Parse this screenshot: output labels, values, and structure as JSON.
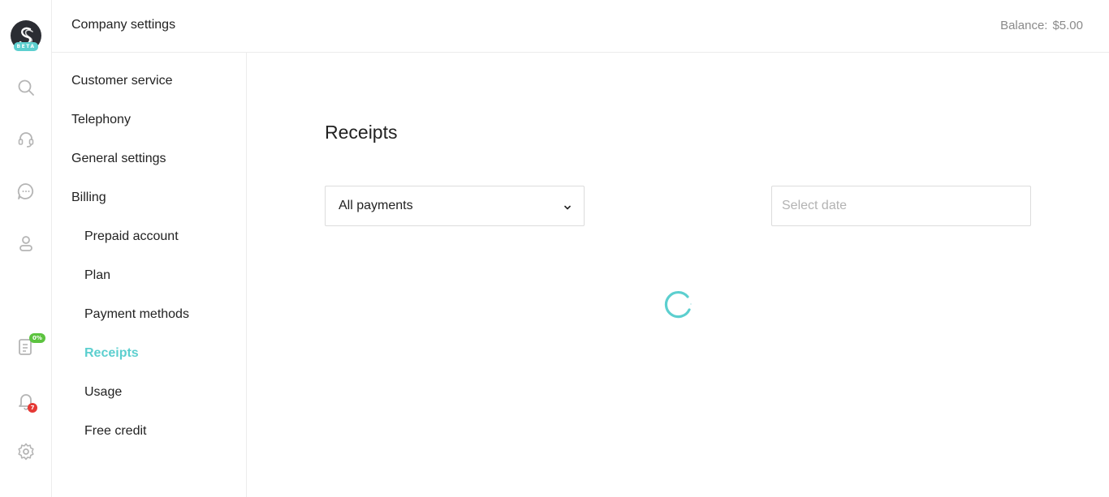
{
  "header": {
    "title": "Company settings",
    "balance_label": "Balance:",
    "balance_value": "$5.00"
  },
  "rail": {
    "logo_badge": "BETA",
    "icons": [
      "search-icon",
      "headset-icon",
      "chat-icon",
      "user-icon",
      "checklist-icon",
      "bell-icon",
      "gear-icon"
    ],
    "checklist_badge": "0%",
    "notifications_badge": "7",
    "colors": {
      "accent": "#5ccfcf",
      "green_badge": "#5cc33f",
      "red_badge": "#e53935"
    }
  },
  "nav": {
    "items": [
      {
        "label": "Customer service",
        "level": 0
      },
      {
        "label": "Telephony",
        "level": 0
      },
      {
        "label": "General settings",
        "level": 0
      },
      {
        "label": "Billing",
        "level": 0
      },
      {
        "label": "Prepaid account",
        "level": 1
      },
      {
        "label": "Plan",
        "level": 1
      },
      {
        "label": "Payment methods",
        "level": 1
      },
      {
        "label": "Receipts",
        "level": 1,
        "active": true
      },
      {
        "label": "Usage",
        "level": 1
      },
      {
        "label": "Free credit",
        "level": 1
      }
    ]
  },
  "main": {
    "title": "Receipts",
    "filter_value": "All payments",
    "date_placeholder": "Select date",
    "loading": true
  }
}
